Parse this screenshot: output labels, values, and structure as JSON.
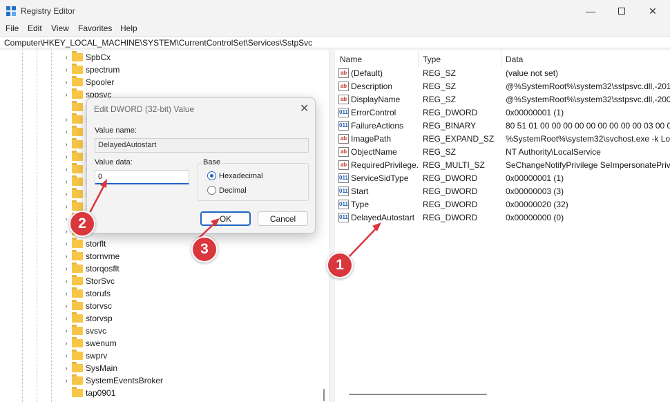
{
  "window": {
    "title": "Registry Editor",
    "app_icon": "registry-editor-icon"
  },
  "menu": [
    "File",
    "Edit",
    "View",
    "Favorites",
    "Help"
  ],
  "address": "Computer\\HKEY_LOCAL_MACHINE\\SYSTEM\\CurrentControlSet\\Services\\SstpSvc",
  "tree": {
    "items": [
      {
        "label": "SpbCx"
      },
      {
        "label": "spectrum"
      },
      {
        "label": "Spooler"
      },
      {
        "label": "sppsvc"
      },
      {
        "label": "s"
      },
      {
        "label": "s"
      },
      {
        "label": "S"
      },
      {
        "label": "s"
      },
      {
        "label": "S"
      },
      {
        "label": "s"
      },
      {
        "label": "s"
      },
      {
        "label": "s"
      },
      {
        "label": "s"
      },
      {
        "label": "s"
      },
      {
        "label": "s"
      },
      {
        "label": "storflt"
      },
      {
        "label": "stornvme"
      },
      {
        "label": "storqosflt"
      },
      {
        "label": "StorSvc"
      },
      {
        "label": "storufs"
      },
      {
        "label": "storvsc"
      },
      {
        "label": "storvsp"
      },
      {
        "label": "svsvc"
      },
      {
        "label": "swenum"
      },
      {
        "label": "swprv"
      },
      {
        "label": "SysMain"
      },
      {
        "label": "SystemEventsBroker"
      },
      {
        "label": "tap0901"
      }
    ]
  },
  "list": {
    "columns": [
      "Name",
      "Type",
      "Data"
    ],
    "rows": [
      {
        "icon": "ab",
        "name": "(Default)",
        "type": "REG_SZ",
        "data": "(value not set)"
      },
      {
        "icon": "ab",
        "name": "Description",
        "type": "REG_SZ",
        "data": "@%SystemRoot%\\system32\\sstpsvc.dll,-201"
      },
      {
        "icon": "ab",
        "name": "DisplayName",
        "type": "REG_SZ",
        "data": "@%SystemRoot%\\system32\\sstpsvc.dll,-200"
      },
      {
        "icon": "bin",
        "name": "ErrorControl",
        "type": "REG_DWORD",
        "data": "0x00000001 (1)"
      },
      {
        "icon": "bin",
        "name": "FailureActions",
        "type": "REG_BINARY",
        "data": "80 51 01 00 00 00 00 00 00 00 00 00 03 00 00 00"
      },
      {
        "icon": "ab",
        "name": "ImagePath",
        "type": "REG_EXPAND_SZ",
        "data": "%SystemRoot%\\system32\\svchost.exe -k Loc"
      },
      {
        "icon": "ab",
        "name": "ObjectName",
        "type": "REG_SZ",
        "data": "NT Authority\\LocalService"
      },
      {
        "icon": "ab",
        "name": "RequiredPrivilege...",
        "type": "REG_MULTI_SZ",
        "data": "SeChangeNotifyPrivilege SeImpersonatePrivi"
      },
      {
        "icon": "bin",
        "name": "ServiceSidType",
        "type": "REG_DWORD",
        "data": "0x00000001 (1)"
      },
      {
        "icon": "bin",
        "name": "Start",
        "type": "REG_DWORD",
        "data": "0x00000003 (3)"
      },
      {
        "icon": "bin",
        "name": "Type",
        "type": "REG_DWORD",
        "data": "0x00000020 (32)"
      },
      {
        "icon": "bin",
        "name": "DelayedAutostart",
        "type": "REG_DWORD",
        "data": "0x00000000 (0)"
      }
    ]
  },
  "dialog": {
    "title": "Edit DWORD (32-bit) Value",
    "value_name_label": "Value name:",
    "value_name": "DelayedAutostart",
    "value_data_label": "Value data:",
    "value_data": "0",
    "base_label": "Base",
    "options": [
      {
        "label": "Hexadecimal",
        "selected": true
      },
      {
        "label": "Decimal",
        "selected": false
      }
    ],
    "ok_label": "OK",
    "cancel_label": "Cancel"
  },
  "annotations": {
    "badges": [
      "1",
      "2",
      "3"
    ],
    "color": "#d9363e"
  }
}
